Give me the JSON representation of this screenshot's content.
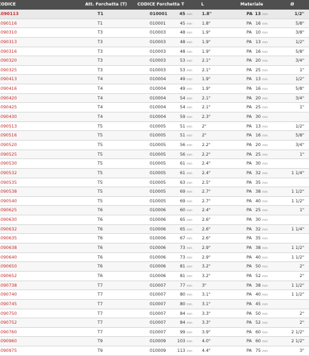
{
  "header": {
    "col_code": "CODICE",
    "col_att": "Att. Forchetta (T)",
    "col_code_fork": "CODICE Forchetta T",
    "col_len": "L",
    "col_mat": "Materiale",
    "col_dia": "Ø"
  },
  "unit_mm": "mm",
  "rows": [
    {
      "code": "1090113",
      "att": "T1",
      "cf": "010001",
      "len": "45",
      "inch": "1.8\"",
      "mat": "PA",
      "mm": "13",
      "frac": "1/2\""
    },
    {
      "code": "1090116",
      "att": "T1",
      "cf": "010001",
      "len": "45",
      "inch": "1.8\"",
      "mat": "PA",
      "mm": "16",
      "frac": "5/8\""
    },
    {
      "code": "1090310",
      "att": "T3",
      "cf": "010003",
      "len": "48",
      "inch": "1.9\"",
      "mat": "PA",
      "mm": "10",
      "frac": "3/8\""
    },
    {
      "code": "1090313",
      "att": "T3",
      "cf": "010003",
      "len": "48",
      "inch": "1.9\"",
      "mat": "PA",
      "mm": "13",
      "frac": "1/2\""
    },
    {
      "code": "1090316",
      "att": "T3",
      "cf": "010003",
      "len": "48",
      "inch": "1.9\"",
      "mat": "PA",
      "mm": "16",
      "frac": "5/8\""
    },
    {
      "code": "1090320",
      "att": "T3",
      "cf": "010003",
      "len": "53",
      "inch": "2.1\"",
      "mat": "PA",
      "mm": "20",
      "frac": "3/4\""
    },
    {
      "code": "1090325",
      "att": "T3",
      "cf": "010003",
      "len": "53",
      "inch": "2.1\"",
      "mat": "PA",
      "mm": "25",
      "frac": "1\""
    },
    {
      "code": "1090413",
      "att": "T4",
      "cf": "010004",
      "len": "49",
      "inch": "1.9\"",
      "mat": "PA",
      "mm": "13",
      "frac": "1/2\""
    },
    {
      "code": "1090416",
      "att": "T4",
      "cf": "010004",
      "len": "49",
      "inch": "1.9\"",
      "mat": "PA",
      "mm": "16",
      "frac": "5/8\""
    },
    {
      "code": "1090420",
      "att": "T4",
      "cf": "010004",
      "len": "54",
      "inch": "2.1\"",
      "mat": "PA",
      "mm": "20",
      "frac": "3/4\""
    },
    {
      "code": "1090425",
      "att": "T4",
      "cf": "010004",
      "len": "54",
      "inch": "2.1\"",
      "mat": "PA",
      "mm": "25",
      "frac": "1\""
    },
    {
      "code": "1090430",
      "att": "T4",
      "cf": "010004",
      "len": "59",
      "inch": "2.3\"",
      "mat": "PA",
      "mm": "30",
      "frac": ""
    },
    {
      "code": "1090513",
      "att": "T5",
      "cf": "010005",
      "len": "51",
      "inch": "2\"",
      "mat": "PA",
      "mm": "13",
      "frac": "1/2\""
    },
    {
      "code": "1090516",
      "att": "T5",
      "cf": "010005",
      "len": "51",
      "inch": "2\"",
      "mat": "PA",
      "mm": "16",
      "frac": "5/8\""
    },
    {
      "code": "1090520",
      "att": "T5",
      "cf": "010005",
      "len": "56",
      "inch": "2.2\"",
      "mat": "PA",
      "mm": "20",
      "frac": "3/4\""
    },
    {
      "code": "1090525",
      "att": "T5",
      "cf": "010005",
      "len": "56",
      "inch": "2.2\"",
      "mat": "PA",
      "mm": "25",
      "frac": "1\""
    },
    {
      "code": "1090530",
      "att": "T5",
      "cf": "010005",
      "len": "61",
      "inch": "2.4\"",
      "mat": "PA",
      "mm": "30",
      "frac": ""
    },
    {
      "code": "1090532",
      "att": "T5",
      "cf": "010005",
      "len": "61",
      "inch": "2.4\"",
      "mat": "PA",
      "mm": "32",
      "frac": "1 1/4\""
    },
    {
      "code": "1090535",
      "att": "T5",
      "cf": "010005",
      "len": "63",
      "inch": "2.5\"",
      "mat": "PA",
      "mm": "35",
      "frac": ""
    },
    {
      "code": "1090538",
      "att": "T5",
      "cf": "010005",
      "len": "69",
      "inch": "2.7\"",
      "mat": "PA",
      "mm": "38",
      "frac": "1 1/2\""
    },
    {
      "code": "1090540",
      "att": "T5",
      "cf": "010005",
      "len": "69",
      "inch": "2.7\"",
      "mat": "PA",
      "mm": "40",
      "frac": "1 1/2\""
    },
    {
      "code": "1090625",
      "att": "T6",
      "cf": "010006",
      "len": "60",
      "inch": "2.4\"",
      "mat": "PA",
      "mm": "25",
      "frac": "1\""
    },
    {
      "code": "1090630",
      "att": "T6",
      "cf": "010006",
      "len": "65",
      "inch": "2.6\"",
      "mat": "PA",
      "mm": "30",
      "frac": ""
    },
    {
      "code": "1090632",
      "att": "T6",
      "cf": "010006",
      "len": "65",
      "inch": "2.6\"",
      "mat": "PA",
      "mm": "32",
      "frac": "1 1/4\""
    },
    {
      "code": "1090635",
      "att": "T6",
      "cf": "010006",
      "len": "67",
      "inch": "2.6\"",
      "mat": "PA",
      "mm": "35",
      "frac": ""
    },
    {
      "code": "1090638",
      "att": "T6",
      "cf": "010006",
      "len": "73",
      "inch": "2.9\"",
      "mat": "PA",
      "mm": "38",
      "frac": "1 1/2\""
    },
    {
      "code": "1090640",
      "att": "T6",
      "cf": "010006",
      "len": "73",
      "inch": "2.9\"",
      "mat": "PA",
      "mm": "40",
      "frac": "1 1/2\""
    },
    {
      "code": "1090650",
      "att": "T6",
      "cf": "010006",
      "len": "81",
      "inch": "3.2\"",
      "mat": "PA",
      "mm": "50",
      "frac": "2\""
    },
    {
      "code": "1090652",
      "att": "T6",
      "cf": "010006",
      "len": "81",
      "inch": "3.2\"",
      "mat": "PA",
      "mm": "52",
      "frac": "2\""
    },
    {
      "code": "1090738",
      "att": "T7",
      "cf": "010007",
      "len": "77",
      "inch": "3\"",
      "mat": "PA",
      "mm": "38",
      "frac": "1 1/2\""
    },
    {
      "code": "1090740",
      "att": "T7",
      "cf": "010007",
      "len": "80",
      "inch": "3.1\"",
      "mat": "PA",
      "mm": "40",
      "frac": "1 1/2\""
    },
    {
      "code": "1090745",
      "att": "T7",
      "cf": "010007",
      "len": "80",
      "inch": "3.1\"",
      "mat": "PA",
      "mm": "45",
      "frac": ""
    },
    {
      "code": "1090750",
      "att": "T7",
      "cf": "010007",
      "len": "84",
      "inch": "3.3\"",
      "mat": "PA",
      "mm": "50",
      "frac": "2\""
    },
    {
      "code": "1090752",
      "att": "T7",
      "cf": "010007",
      "len": "84",
      "inch": "3.3\"",
      "mat": "PA",
      "mm": "52",
      "frac": "2\""
    },
    {
      "code": "1090760",
      "att": "T7",
      "cf": "010007",
      "len": "99",
      "inch": "3.9\"",
      "mat": "PA",
      "mm": "60",
      "frac": "2 1/2\""
    },
    {
      "code": "1090960",
      "att": "T9",
      "cf": "010009",
      "len": "103",
      "inch": "4.0\"",
      "mat": "PA",
      "mm": "60",
      "frac": "2 1/2\""
    },
    {
      "code": "1090975",
      "att": "T9",
      "cf": "010009",
      "len": "113",
      "inch": "4.4\"",
      "mat": "PA",
      "mm": "75",
      "frac": "3\""
    }
  ]
}
